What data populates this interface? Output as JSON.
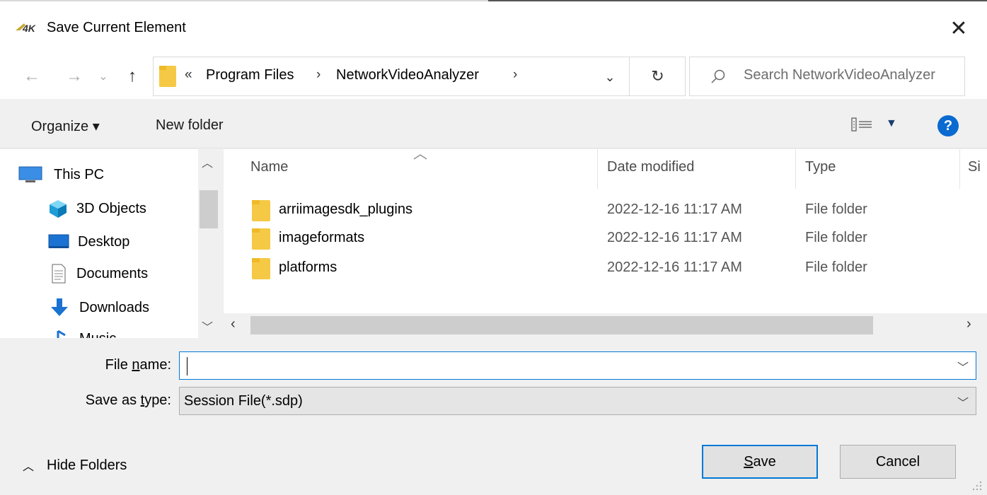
{
  "window": {
    "title": "Save Current Element",
    "close_glyph": "✕"
  },
  "nav": {
    "back_glyph": "←",
    "forward_glyph": "→",
    "recent_glyph": "⌄",
    "up_glyph": "↑",
    "breadcrumb_overflow": "«",
    "breadcrumbs": [
      "Program Files",
      "NetworkVideoAnalyzer"
    ],
    "sep_glyph": "›",
    "dropdown_glyph": "⌄",
    "refresh_glyph": "↻"
  },
  "search": {
    "placeholder": "Search NetworkVideoAnalyzer"
  },
  "toolbar": {
    "organize_label": "Organize ▾",
    "new_folder_label": "New folder",
    "help_glyph": "?"
  },
  "sidebar": {
    "items": [
      {
        "label": "This PC",
        "icon": "monitor-icon"
      },
      {
        "label": "3D Objects",
        "icon": "cube-icon"
      },
      {
        "label": "Desktop",
        "icon": "desktop-icon"
      },
      {
        "label": "Documents",
        "icon": "document-icon"
      },
      {
        "label": "Downloads",
        "icon": "download-icon"
      },
      {
        "label": "Music",
        "icon": "music-icon"
      }
    ]
  },
  "filelist": {
    "columns": [
      "Name",
      "Date modified",
      "Type",
      "Si"
    ],
    "rows": [
      {
        "name": "arriimagesdk_plugins",
        "date": "2022-12-16 11:17 AM",
        "type": "File folder"
      },
      {
        "name": "imageformats",
        "date": "2022-12-16 11:17 AM",
        "type": "File folder"
      },
      {
        "name": "platforms",
        "date": "2022-12-16 11:17 AM",
        "type": "File folder"
      }
    ]
  },
  "form": {
    "file_name_label_pre": "File ",
    "file_name_label_u": "n",
    "file_name_label_post": "ame:",
    "file_name_value": "",
    "save_type_label_pre": "Save as ",
    "save_type_label_u": "t",
    "save_type_label_post": "ype:",
    "save_type_value": "Session File(*.sdp)"
  },
  "footer": {
    "hide_folders_label": "Hide Folders",
    "save_label_u": "S",
    "save_label_post": "ave",
    "cancel_label": "Cancel"
  },
  "colors": {
    "accent": "#0078d7",
    "folder": "#f5c945",
    "help": "#0a6ad1"
  }
}
